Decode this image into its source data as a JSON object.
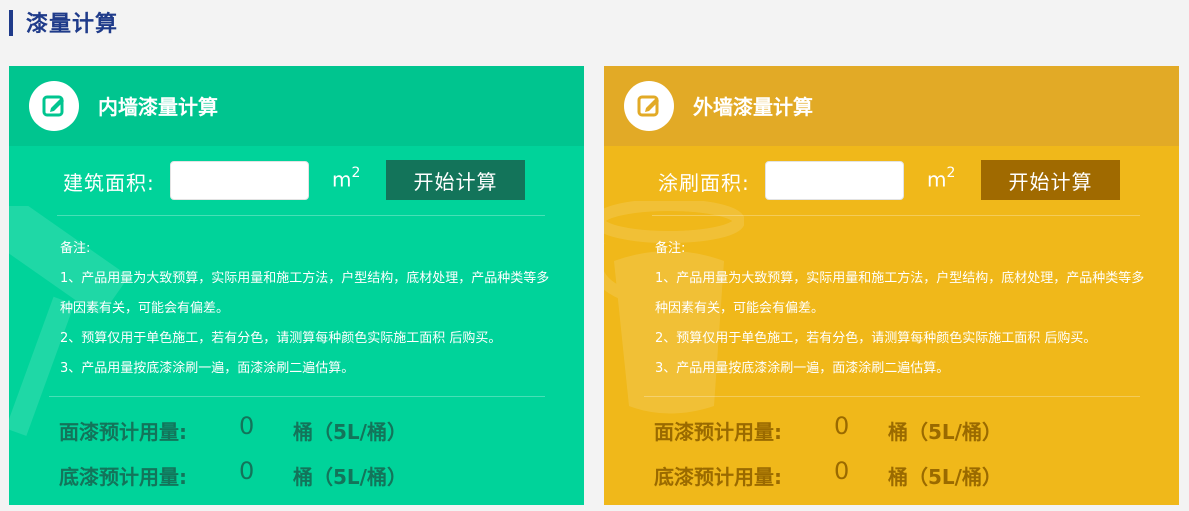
{
  "page": {
    "title": "漆量计算"
  },
  "cards": [
    {
      "title": "内墙漆量计算",
      "area_label": "建筑面积:",
      "area_value": "",
      "unit": "m",
      "unit_sup": "2",
      "button_label": "开始计算",
      "notes": [
        "备注:",
        "1、产品用量为大致预算，实际用量和施工方法，户型结构，底材处理，产品种类等多种因素有关，可能会有偏差。",
        "2、预算仅用于单色施工，若有分色，请测算每种颜色实际施工面积 后购买。",
        "3、产品用量按底漆涂刷一遍，面漆涂刷二遍估算。"
      ],
      "results": [
        {
          "label": "面漆预计用量:",
          "value": "0",
          "unit": "桶（5L/桶）"
        },
        {
          "label": "底漆预计用量:",
          "value": "0",
          "unit": "桶（5L/桶）"
        }
      ]
    },
    {
      "title": "外墙漆量计算",
      "area_label": "涂刷面积:",
      "area_value": "",
      "unit": "m",
      "unit_sup": "2",
      "button_label": "开始计算",
      "notes": [
        "备注:",
        "1、产品用量为大致预算，实际用量和施工方法，户型结构，底材处理，产品种类等多种因素有关，可能会有偏差。",
        "2、预算仅用于单色施工，若有分色，请测算每种颜色实际施工面积 后购买。",
        "3、产品用量按底漆涂刷一遍，面漆涂刷二遍估算。"
      ],
      "results": [
        {
          "label": "面漆预计用量:",
          "value": "0",
          "unit": "桶（5L/桶）"
        },
        {
          "label": "底漆预计用量:",
          "value": "0",
          "unit": "桶（5L/桶）"
        }
      ]
    }
  ],
  "colors": {
    "title_blue": "#1f3b8a",
    "green_card": "#00d39a",
    "green_head": "#00c58f",
    "green_button": "#13745a",
    "yellow_card": "#f0b81a",
    "yellow_head": "#e2aa26",
    "yellow_button": "#a06a00"
  },
  "icons": {
    "card_icon": "edit-icon",
    "green_watermark": "paint-roller-icon",
    "yellow_watermark": "paint-bucket-icon"
  }
}
